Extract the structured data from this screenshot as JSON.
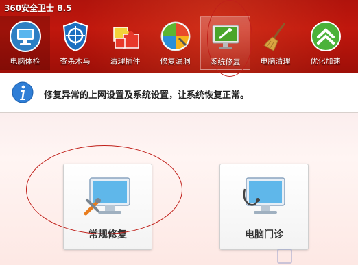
{
  "window": {
    "title": "360安全卫士 8.5"
  },
  "toolbar": {
    "items": [
      {
        "label": "电脑体检",
        "icon": "monitor-check-icon"
      },
      {
        "label": "查杀木马",
        "icon": "shield-target-icon"
      },
      {
        "label": "清理插件",
        "icon": "puzzle-icon"
      },
      {
        "label": "修复漏洞",
        "icon": "windows-shield-icon"
      },
      {
        "label": "系统修复",
        "icon": "monitor-wrench-icon"
      },
      {
        "label": "电脑清理",
        "icon": "broom-icon"
      },
      {
        "label": "优化加速",
        "icon": "chevron-up-circle-icon"
      }
    ],
    "active_index": 4
  },
  "info": {
    "text": "修复异常的上网设置及系统设置，让系统恢复正常。",
    "icon": "info-icon"
  },
  "cards": [
    {
      "label": "常规修复",
      "icon": "monitor-tools-icon"
    },
    {
      "label": "电脑门诊",
      "icon": "monitor-stethoscope-icon"
    }
  ],
  "colors": {
    "header": "#b0130c",
    "accent_ellipse": "#c0201a"
  }
}
